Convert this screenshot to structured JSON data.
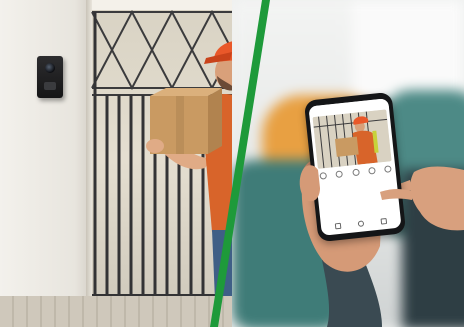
{
  "scene": {
    "description_left": "",
    "accent_color": "#1e9a3a",
    "courier_cap_color": "#e9582a",
    "courier_shirt_color": "#d8642a",
    "package_color": "#c99a62"
  },
  "icons": {
    "doorbell": "video-doorbell-icon",
    "phone_app": "doorbell-app-icon"
  },
  "phone": {
    "app_header": "",
    "feed": {
      "subject": "courier-with-package"
    },
    "controls": [
      "mic-icon",
      "speaker-icon",
      "snapshot-icon",
      "record-icon",
      "more-icon"
    ],
    "bottom_nav": [
      "home-icon",
      "gallery-icon",
      "settings-icon"
    ]
  }
}
